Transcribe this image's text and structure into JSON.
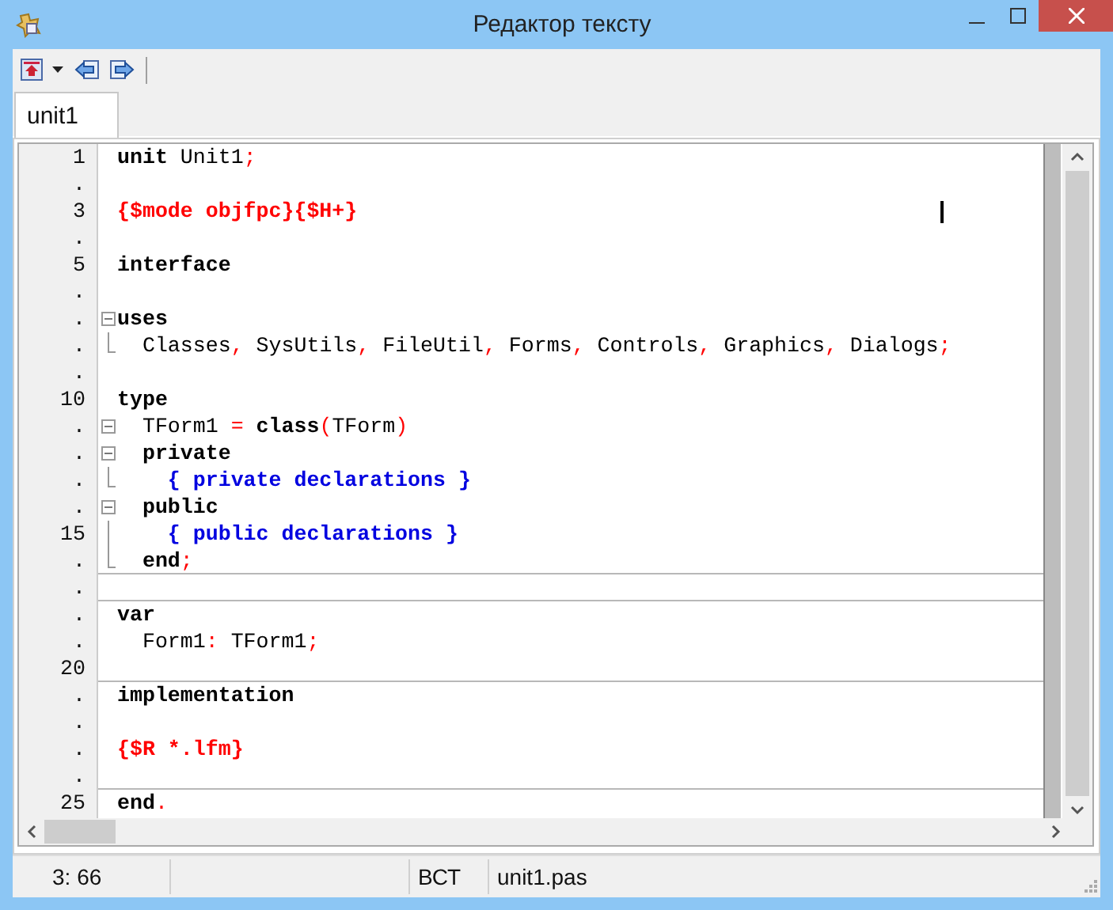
{
  "window": {
    "title": "Редактор тексту"
  },
  "toolbar": {
    "items": [
      {
        "kind": "home",
        "dropdown": true
      },
      {
        "kind": "back",
        "dropdown": false
      },
      {
        "kind": "forward",
        "dropdown": false
      }
    ]
  },
  "tabs": [
    {
      "label": "unit1",
      "selected": true
    }
  ],
  "editor": {
    "lines": [
      {
        "number": "1",
        "kind": "plain",
        "divider": false,
        "cursor": false,
        "tokens": [
          {
            "kind": "kw",
            "text": "unit"
          },
          {
            "kind": "text",
            "text": " Unit1"
          },
          {
            "kind": "sym",
            "text": ";"
          }
        ]
      },
      {
        "number": ".",
        "kind": "plain",
        "divider": false,
        "cursor": false
      },
      {
        "number": "3",
        "kind": "plain",
        "divider": false,
        "cursor": true,
        "tokens": [
          {
            "kind": "dir",
            "text": "{$mode objfpc}{$H+}"
          }
        ]
      },
      {
        "number": ".",
        "kind": "plain",
        "divider": false,
        "cursor": false
      },
      {
        "number": "5",
        "kind": "plain",
        "divider": false,
        "cursor": false,
        "tokens": [
          {
            "kind": "kw",
            "text": "interface"
          }
        ]
      },
      {
        "number": ".",
        "kind": "plain",
        "divider": false,
        "cursor": false
      },
      {
        "number": ".",
        "kind": "fold_start",
        "divider": false,
        "cursor": false,
        "tokens": [
          {
            "kind": "kw",
            "text": "uses"
          }
        ]
      },
      {
        "number": ".",
        "kind": "fold_end",
        "divider": false,
        "cursor": false,
        "tokens": [
          {
            "kind": "text",
            "text": "  Classes"
          },
          {
            "kind": "sym",
            "text": ","
          },
          {
            "kind": "text",
            "text": " SysUtils"
          },
          {
            "kind": "sym",
            "text": ","
          },
          {
            "kind": "text",
            "text": " FileUtil"
          },
          {
            "kind": "sym",
            "text": ","
          },
          {
            "kind": "text",
            "text": " Forms"
          },
          {
            "kind": "sym",
            "text": ","
          },
          {
            "kind": "text",
            "text": " Controls"
          },
          {
            "kind": "sym",
            "text": ","
          },
          {
            "kind": "text",
            "text": " Graphics"
          },
          {
            "kind": "sym",
            "text": ","
          },
          {
            "kind": "text",
            "text": " Dialogs"
          },
          {
            "kind": "sym",
            "text": ";"
          }
        ]
      },
      {
        "number": ".",
        "kind": "plain",
        "divider": false,
        "cursor": false
      },
      {
        "number": "10",
        "kind": "plain",
        "divider": false,
        "cursor": false,
        "tokens": [
          {
            "kind": "kw",
            "text": "type"
          }
        ]
      },
      {
        "number": ".",
        "kind": "fold_start",
        "divider": false,
        "cursor": false,
        "tokens": [
          {
            "kind": "text",
            "text": "  TForm1 "
          },
          {
            "kind": "sym",
            "text": "="
          },
          {
            "kind": "kw",
            "text": " class"
          },
          {
            "kind": "sym",
            "text": "("
          },
          {
            "kind": "text",
            "text": "TForm"
          },
          {
            "kind": "sym",
            "text": ")"
          }
        ]
      },
      {
        "number": ".",
        "kind": "fold_start",
        "divider": false,
        "cursor": false,
        "tokens": [
          {
            "kind": "kw",
            "text": "  private"
          }
        ]
      },
      {
        "number": ".",
        "kind": "fold_end",
        "divider": false,
        "cursor": false,
        "tokens": [
          {
            "kind": "comment",
            "text": "    { private declarations }"
          }
        ]
      },
      {
        "number": ".",
        "kind": "fold_start",
        "divider": false,
        "cursor": false,
        "tokens": [
          {
            "kind": "kw",
            "text": "  public"
          }
        ]
      },
      {
        "number": "15",
        "kind": "fold_mid",
        "divider": false,
        "cursor": false,
        "tokens": [
          {
            "kind": "comment",
            "text": "    { public declarations }"
          }
        ]
      },
      {
        "number": ".",
        "kind": "fold_end",
        "divider": true,
        "cursor": false,
        "tokens": [
          {
            "kind": "kw",
            "text": "  end"
          },
          {
            "kind": "sym",
            "text": ";"
          }
        ]
      },
      {
        "number": ".",
        "kind": "plain",
        "divider": true,
        "cursor": false
      },
      {
        "number": ".",
        "kind": "plain",
        "divider": false,
        "cursor": false,
        "tokens": [
          {
            "kind": "kw",
            "text": "var"
          }
        ]
      },
      {
        "number": ".",
        "kind": "plain",
        "divider": false,
        "cursor": false,
        "tokens": [
          {
            "kind": "text",
            "text": "  Form1"
          },
          {
            "kind": "sym",
            "text": ":"
          },
          {
            "kind": "text",
            "text": " TForm1"
          },
          {
            "kind": "sym",
            "text": ";"
          }
        ]
      },
      {
        "number": "20",
        "kind": "plain",
        "divider": true,
        "cursor": false
      },
      {
        "number": ".",
        "kind": "plain",
        "divider": false,
        "cursor": false,
        "tokens": [
          {
            "kind": "kw",
            "text": "implementation"
          }
        ]
      },
      {
        "number": ".",
        "kind": "plain",
        "divider": false,
        "cursor": false
      },
      {
        "number": ".",
        "kind": "plain",
        "divider": false,
        "cursor": false,
        "tokens": [
          {
            "kind": "dir",
            "text": "{$R *.lfm}"
          }
        ]
      },
      {
        "number": ".",
        "kind": "plain",
        "divider": true,
        "cursor": false
      },
      {
        "number": "25",
        "kind": "plain",
        "divider": false,
        "cursor": false,
        "tokens": [
          {
            "kind": "kw",
            "text": "end"
          },
          {
            "kind": "sym",
            "text": "."
          }
        ]
      }
    ]
  },
  "status_bar": {
    "position": "3: 66",
    "mode": "ВСТ",
    "file": "unit1.pas"
  }
}
